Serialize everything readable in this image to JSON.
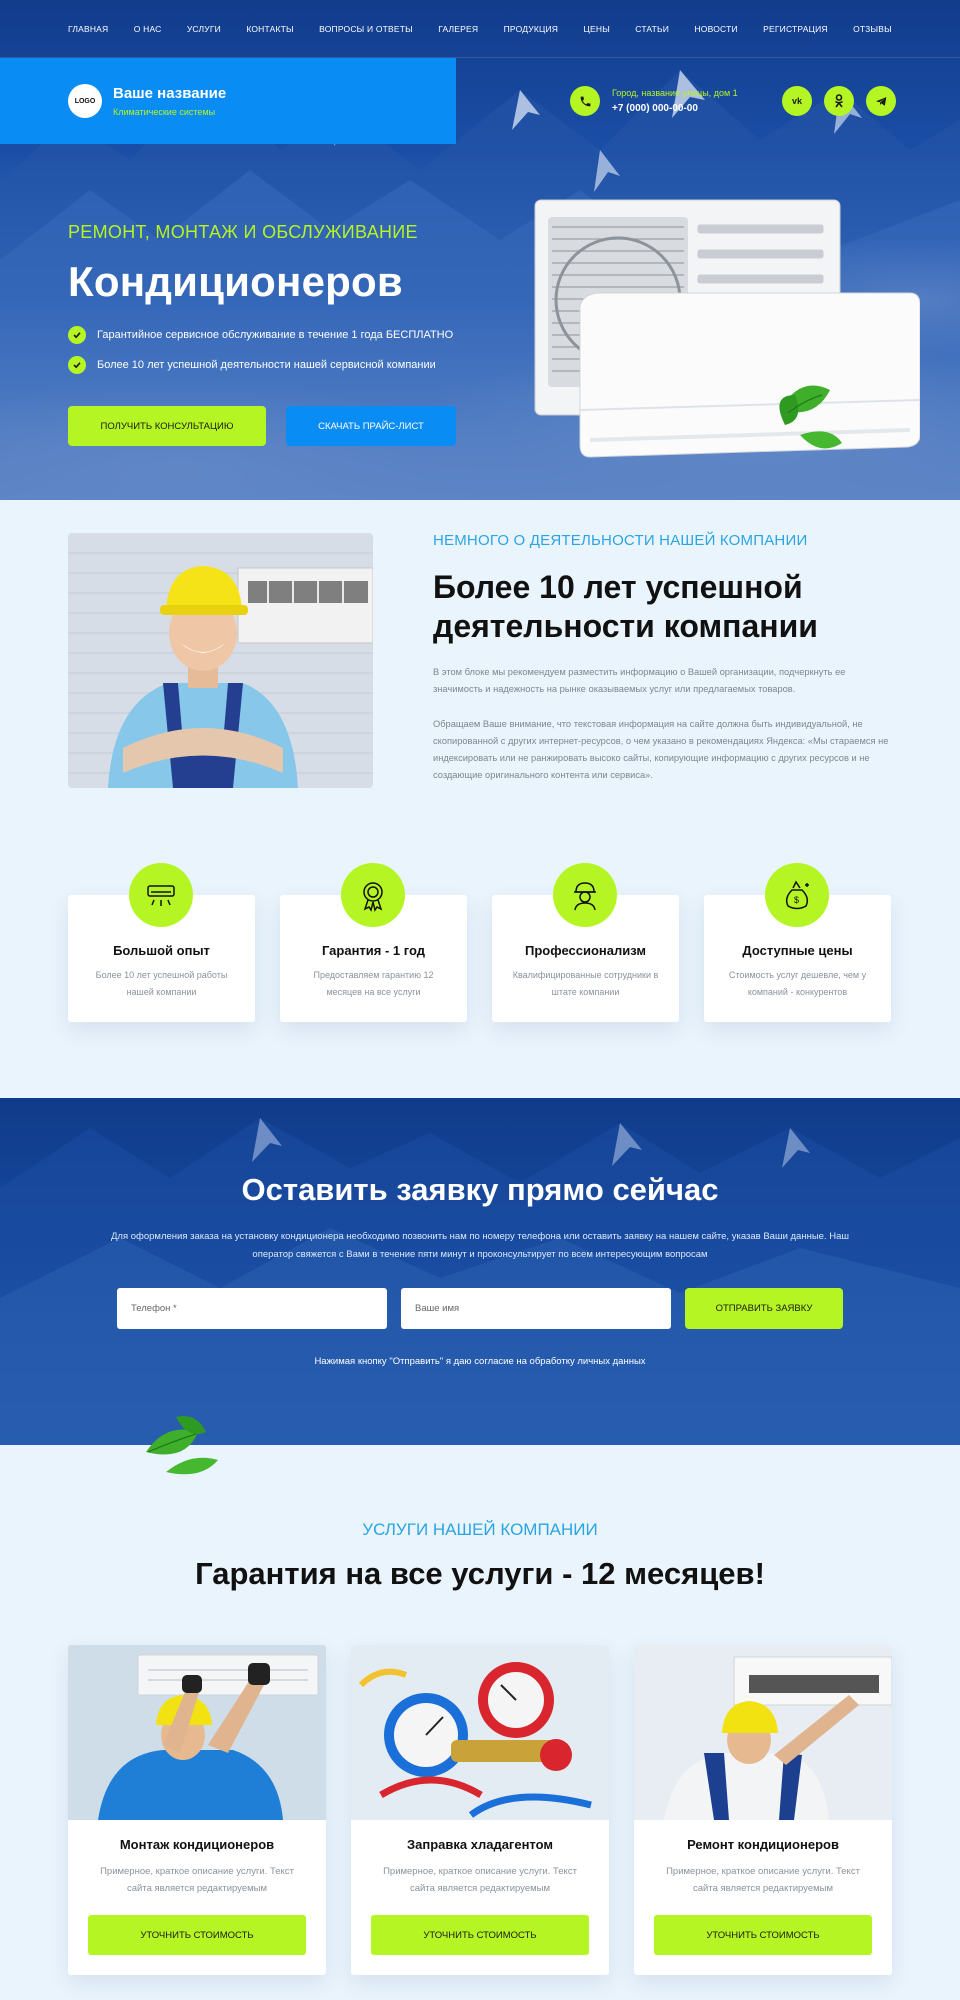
{
  "nav": {
    "items": [
      "ГЛАВНАЯ",
      "О НАС",
      "УСЛУГИ",
      "КОНТАКТЫ",
      "ВОПРОСЫ И ОТВЕТЫ",
      "ГАЛЕРЕЯ",
      "ПРОДУКЦИЯ",
      "ЦЕНЫ",
      "СТАТЬИ",
      "НОВОСТИ",
      "РЕГИСТРАЦИЯ",
      "ОТЗЫВЫ"
    ]
  },
  "brand": {
    "logo": "LOGO",
    "name": "Ваше название",
    "tagline": "Климатические системы"
  },
  "contact": {
    "address": "Город, название улицы, дом 1",
    "phone": "+7 (000) 000-00-00",
    "icons": [
      "phone-icon",
      "vk-icon",
      "odnoklassniki-icon",
      "telegram-icon"
    ]
  },
  "hero": {
    "subtitle": "РЕМОНТ, МОНТАЖ И ОБСЛУЖИВАНИЕ",
    "title": "Кондиционеров",
    "bullets": [
      "Гарантийное сервисное обслуживание в течение 1 года БЕСПЛАТНО",
      "Более 10 лет успешной деятельности нашей сервисной компании"
    ],
    "btn_consult": "ПОЛУЧИТЬ КОНСУЛЬТАЦИЮ",
    "btn_price": "СКАЧАТЬ ПРАЙС-ЛИСТ"
  },
  "about": {
    "subtitle": "НЕМНОГО О ДЕЯТЕЛЬНОСТИ НАШЕЙ КОМПАНИИ",
    "title": "Более 10 лет успешной деятельности компании",
    "p1": "В этом блоке мы рекомендуем разместить информацию о Вашей организации, подчеркнуть ее значимость и надежность на рынке оказываемых услуг или предлагаемых товаров.",
    "p2": "Обращаем Ваше внимание, что текстовая информация на сайте должна быть индивидуальной, не скопированной с других интернет-ресурсов, о чем указано в рекомендациях Яндекса: «Мы стараемся не индексировать или не ранжировать высоко сайты, копирующие информацию с других ресурсов и не создающие оригинального контента или сервиса»."
  },
  "features": [
    {
      "title": "Большой опыт",
      "text": "Более 10 лет успешной работы нашей компании",
      "icon": "air-conditioner-icon"
    },
    {
      "title": "Гарантия - 1 год",
      "text": "Предоставляем гарантию 12 месяцев на все услуги",
      "icon": "award-medal-icon"
    },
    {
      "title": "Профессионализм",
      "text": "Квалифицированные сотрудники в штате компании",
      "icon": "worker-helmet-icon"
    },
    {
      "title": "Доступные цены",
      "text": "Стоимость услуг дешевле, чем у компаний - конкурентов",
      "icon": "money-bag-icon"
    }
  ],
  "cta": {
    "title": "Оставить заявку прямо сейчас",
    "text": "Для оформления заказа на установку кондиционера необходимо позвонить нам по номеру телефона или оставить заявку на нашем сайте, указав Ваши данные. Наш оператор свяжется с Вами в течение пяти минут и проконсультирует по всем интересующим вопросам",
    "phone_placeholder": "Телефон *",
    "name_placeholder": "Ваше имя",
    "submit": "ОТПРАВИТЬ ЗАЯВКУ",
    "note": "Нажимая кнопку \"Отправить\" я даю согласие на обработку личных данных"
  },
  "services": {
    "subtitle": "УСЛУГИ НАШЕЙ КОМПАНИИ",
    "title": "Гарантия на все услуги - 12 месяцев!",
    "cards": [
      {
        "name": "Монтаж кондиционеров",
        "desc": "Примерное, краткое описание услуги. Текст сайта является редактируемым",
        "button": "УТОЧНИТЬ СТОИМОСТЬ"
      },
      {
        "name": "Заправка хладагентом",
        "desc": "Примерное, краткое описание услуги. Текст сайта является редактируемым",
        "button": "УТОЧНИТЬ СТОИМОСТЬ"
      },
      {
        "name": "Ремонт кондиционеров",
        "desc": "Примерное, краткое описание услуги. Текст сайта является редактируемым",
        "button": "УТОЧНИТЬ СТОИМОСТЬ"
      }
    ]
  },
  "colors": {
    "accent_green": "#b5f523",
    "accent_blue": "#0a8cf5",
    "dark_blue": "#123c8c",
    "light_bg": "#eaf4fc"
  }
}
